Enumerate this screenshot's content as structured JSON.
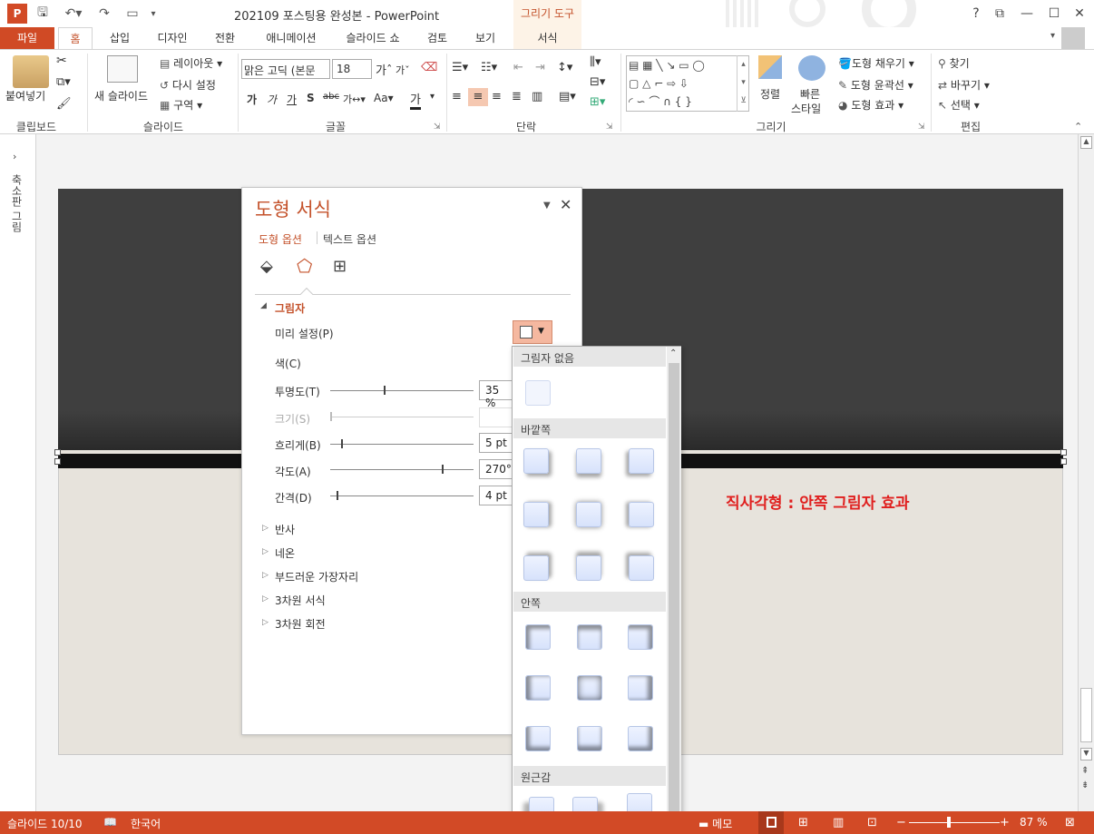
{
  "titlebar": {
    "app_icon": "powerpoint-icon",
    "title": "202109 포스팅용 완성본 - PowerPoint",
    "context_group": "그리기 도구",
    "help": "?",
    "restore": "⧉",
    "minimize": "—",
    "maximize": "☐",
    "close": "✕"
  },
  "tabs": {
    "file": "파일",
    "home": "홈",
    "insert": "삽입",
    "design": "디자인",
    "transitions": "전환",
    "animations": "애니메이션",
    "slideshow": "슬라이드 쇼",
    "review": "검토",
    "view": "보기",
    "format": "서식"
  },
  "ribbon": {
    "clipboard": {
      "paste": "붙여넣기",
      "label": "클립보드"
    },
    "slides": {
      "new_slide": "새 슬라이드",
      "layout": "레이아웃",
      "reset": "다시 설정",
      "section": "구역",
      "label": "슬라이드"
    },
    "font": {
      "font_name": "맑은 고딕 (본문",
      "font_size": "18",
      "label": "글꼴"
    },
    "paragraph": {
      "label": "단락"
    },
    "drawing": {
      "arrange": "정렬",
      "quick_styles_1": "빠른",
      "quick_styles_2": "스타일",
      "shape_fill": "도형 채우기",
      "shape_outline": "도형 윤곽선",
      "shape_effects": "도형 효과",
      "label": "그리기"
    },
    "editing": {
      "find": "찾기",
      "replace": "바꾸기",
      "select": "선택",
      "label": "편집"
    }
  },
  "thumbnail_strip": {
    "label": "축소판 그림"
  },
  "slide": {
    "caption": "직사각형 : 안쪽 그림자 효과"
  },
  "pane": {
    "title": "도형 서식",
    "tab_shape": "도형 옵션",
    "tab_text": "텍스트 옵션",
    "section_shadow": "그림자",
    "presets": "미리 설정(P)",
    "color": "색(C)",
    "transparency": {
      "label": "투명도(T)",
      "value": "35 %",
      "fraction": 0.35
    },
    "size": {
      "label": "크기(S)",
      "value": ""
    },
    "blur": {
      "label": "흐리게(B)",
      "value": "5 pt",
      "fraction": 0.05
    },
    "angle": {
      "label": "각도(A)",
      "value": "270°",
      "fraction": 0.75
    },
    "distance": {
      "label": "간격(D)",
      "value": "4 pt",
      "fraction": 0.02
    },
    "sections": [
      "반사",
      "네온",
      "부드러운 가장자리",
      "3차원 서식",
      "3차원 회전"
    ]
  },
  "gallery": {
    "no_shadow": "그림자 없음",
    "outer": "바깥쪽",
    "inner": "안쪽",
    "perspective": "원근감"
  },
  "statusbar": {
    "slide_count": "슬라이드 10/10",
    "language": "한국어",
    "notes": "메모",
    "zoom": "87 %",
    "zoom_level": 0.87
  },
  "colors": {
    "accent": "#d24a26",
    "pane_title": "#c4522b",
    "caption": "#e0201f"
  }
}
